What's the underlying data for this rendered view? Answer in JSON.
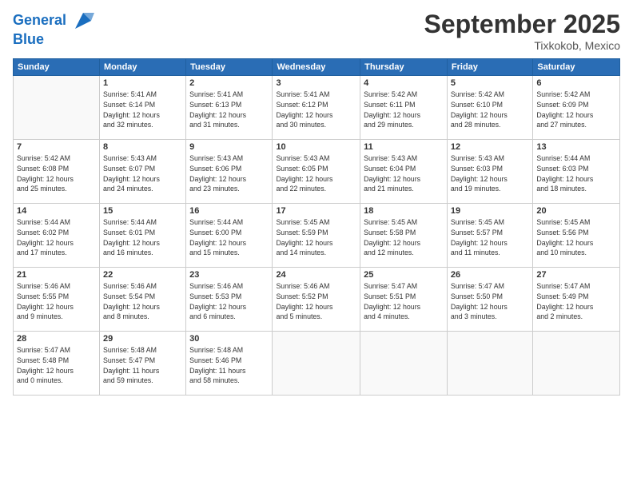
{
  "logo": {
    "line1": "General",
    "line2": "Blue"
  },
  "title": "September 2025",
  "location": "Tixkokob, Mexico",
  "weekdays": [
    "Sunday",
    "Monday",
    "Tuesday",
    "Wednesday",
    "Thursday",
    "Friday",
    "Saturday"
  ],
  "weeks": [
    [
      {
        "day": "",
        "info": ""
      },
      {
        "day": "1",
        "info": "Sunrise: 5:41 AM\nSunset: 6:14 PM\nDaylight: 12 hours\nand 32 minutes."
      },
      {
        "day": "2",
        "info": "Sunrise: 5:41 AM\nSunset: 6:13 PM\nDaylight: 12 hours\nand 31 minutes."
      },
      {
        "day": "3",
        "info": "Sunrise: 5:41 AM\nSunset: 6:12 PM\nDaylight: 12 hours\nand 30 minutes."
      },
      {
        "day": "4",
        "info": "Sunrise: 5:42 AM\nSunset: 6:11 PM\nDaylight: 12 hours\nand 29 minutes."
      },
      {
        "day": "5",
        "info": "Sunrise: 5:42 AM\nSunset: 6:10 PM\nDaylight: 12 hours\nand 28 minutes."
      },
      {
        "day": "6",
        "info": "Sunrise: 5:42 AM\nSunset: 6:09 PM\nDaylight: 12 hours\nand 27 minutes."
      }
    ],
    [
      {
        "day": "7",
        "info": "Sunrise: 5:42 AM\nSunset: 6:08 PM\nDaylight: 12 hours\nand 25 minutes."
      },
      {
        "day": "8",
        "info": "Sunrise: 5:43 AM\nSunset: 6:07 PM\nDaylight: 12 hours\nand 24 minutes."
      },
      {
        "day": "9",
        "info": "Sunrise: 5:43 AM\nSunset: 6:06 PM\nDaylight: 12 hours\nand 23 minutes."
      },
      {
        "day": "10",
        "info": "Sunrise: 5:43 AM\nSunset: 6:05 PM\nDaylight: 12 hours\nand 22 minutes."
      },
      {
        "day": "11",
        "info": "Sunrise: 5:43 AM\nSunset: 6:04 PM\nDaylight: 12 hours\nand 21 minutes."
      },
      {
        "day": "12",
        "info": "Sunrise: 5:43 AM\nSunset: 6:03 PM\nDaylight: 12 hours\nand 19 minutes."
      },
      {
        "day": "13",
        "info": "Sunrise: 5:44 AM\nSunset: 6:03 PM\nDaylight: 12 hours\nand 18 minutes."
      }
    ],
    [
      {
        "day": "14",
        "info": "Sunrise: 5:44 AM\nSunset: 6:02 PM\nDaylight: 12 hours\nand 17 minutes."
      },
      {
        "day": "15",
        "info": "Sunrise: 5:44 AM\nSunset: 6:01 PM\nDaylight: 12 hours\nand 16 minutes."
      },
      {
        "day": "16",
        "info": "Sunrise: 5:44 AM\nSunset: 6:00 PM\nDaylight: 12 hours\nand 15 minutes."
      },
      {
        "day": "17",
        "info": "Sunrise: 5:45 AM\nSunset: 5:59 PM\nDaylight: 12 hours\nand 14 minutes."
      },
      {
        "day": "18",
        "info": "Sunrise: 5:45 AM\nSunset: 5:58 PM\nDaylight: 12 hours\nand 12 minutes."
      },
      {
        "day": "19",
        "info": "Sunrise: 5:45 AM\nSunset: 5:57 PM\nDaylight: 12 hours\nand 11 minutes."
      },
      {
        "day": "20",
        "info": "Sunrise: 5:45 AM\nSunset: 5:56 PM\nDaylight: 12 hours\nand 10 minutes."
      }
    ],
    [
      {
        "day": "21",
        "info": "Sunrise: 5:46 AM\nSunset: 5:55 PM\nDaylight: 12 hours\nand 9 minutes."
      },
      {
        "day": "22",
        "info": "Sunrise: 5:46 AM\nSunset: 5:54 PM\nDaylight: 12 hours\nand 8 minutes."
      },
      {
        "day": "23",
        "info": "Sunrise: 5:46 AM\nSunset: 5:53 PM\nDaylight: 12 hours\nand 6 minutes."
      },
      {
        "day": "24",
        "info": "Sunrise: 5:46 AM\nSunset: 5:52 PM\nDaylight: 12 hours\nand 5 minutes."
      },
      {
        "day": "25",
        "info": "Sunrise: 5:47 AM\nSunset: 5:51 PM\nDaylight: 12 hours\nand 4 minutes."
      },
      {
        "day": "26",
        "info": "Sunrise: 5:47 AM\nSunset: 5:50 PM\nDaylight: 12 hours\nand 3 minutes."
      },
      {
        "day": "27",
        "info": "Sunrise: 5:47 AM\nSunset: 5:49 PM\nDaylight: 12 hours\nand 2 minutes."
      }
    ],
    [
      {
        "day": "28",
        "info": "Sunrise: 5:47 AM\nSunset: 5:48 PM\nDaylight: 12 hours\nand 0 minutes."
      },
      {
        "day": "29",
        "info": "Sunrise: 5:48 AM\nSunset: 5:47 PM\nDaylight: 11 hours\nand 59 minutes."
      },
      {
        "day": "30",
        "info": "Sunrise: 5:48 AM\nSunset: 5:46 PM\nDaylight: 11 hours\nand 58 minutes."
      },
      {
        "day": "",
        "info": ""
      },
      {
        "day": "",
        "info": ""
      },
      {
        "day": "",
        "info": ""
      },
      {
        "day": "",
        "info": ""
      }
    ]
  ]
}
